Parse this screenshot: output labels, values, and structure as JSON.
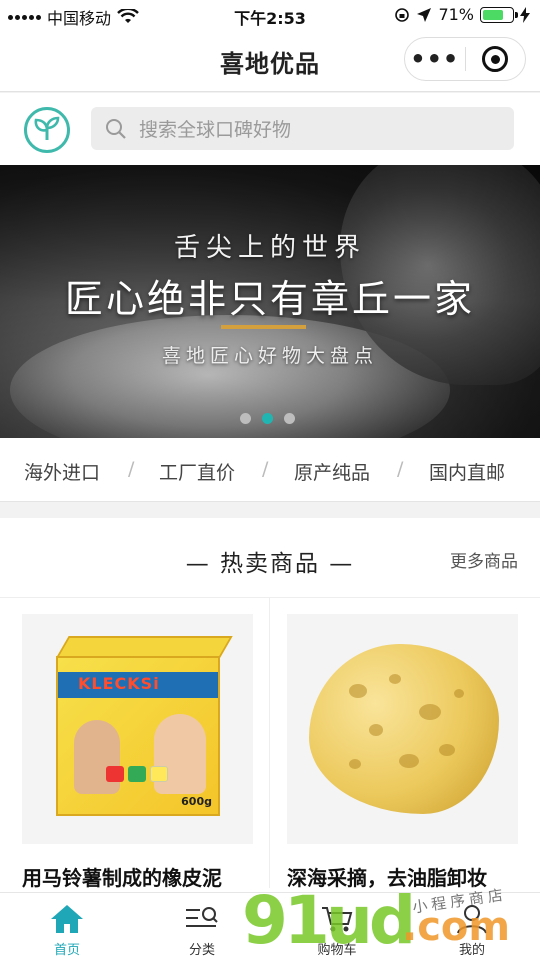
{
  "status_bar": {
    "carrier": "中国移动",
    "time": "下午2:53",
    "battery_percent": "71%",
    "battery_level": 0.71
  },
  "navbar": {
    "title": "喜地优品",
    "more_icon": "more-dots-icon",
    "close_icon": "target-icon"
  },
  "search": {
    "placeholder": "搜索全球口碑好物",
    "logo_icon": "leaf-logo-icon"
  },
  "banner": {
    "subtitle": "舌尖上的世界",
    "title": "匠心绝非只有章丘一家",
    "caption": "喜地匠心好物大盘点",
    "accent_color": "#d4a03e",
    "active_dot_color": "#21b5b2",
    "dots_count": 3,
    "active_dot_index": 1
  },
  "categories": [
    "海外进口",
    "工厂直价",
    "原产纯品",
    "国内直邮"
  ],
  "hot_section": {
    "title": "— 热卖商品 —",
    "more": "更多商品",
    "products": [
      {
        "name": "用马铃薯制成的橡皮泥",
        "box_brand": "KLECKSi",
        "box_weight": "600g"
      },
      {
        "name": "深海采摘，去油脂卸妆"
      }
    ]
  },
  "tabbar": {
    "active_color": "#1fa7b8",
    "tabs": [
      {
        "label": "首页",
        "icon": "home-icon",
        "active": true
      },
      {
        "label": "分类",
        "icon": "category-search-icon",
        "active": false
      },
      {
        "label": "购物车",
        "icon": "cart-icon",
        "active": false
      },
      {
        "label": "我的",
        "icon": "user-icon",
        "active": false
      }
    ]
  },
  "watermark": {
    "main": "91ud",
    "suffix": ".com",
    "tagline": "小程序商店"
  }
}
